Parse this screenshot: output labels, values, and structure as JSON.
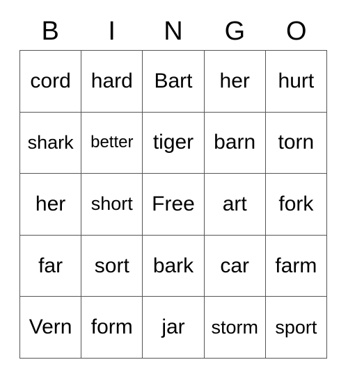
{
  "card": {
    "type": "bingo-card",
    "background_color": "#ffffff",
    "text_color": "#000000",
    "border_color": "#555555",
    "columns": 5,
    "rows": 5,
    "header": {
      "letters": [
        "B",
        "I",
        "N",
        "G",
        "O"
      ]
    },
    "grid": {
      "free_space": {
        "label": "Free",
        "row": 3,
        "column": 3
      },
      "rows": [
        [
          {
            "text": "cord",
            "size": "lg"
          },
          {
            "text": "hard",
            "size": "lg"
          },
          {
            "text": "Bart",
            "size": "lg"
          },
          {
            "text": "her",
            "size": "lg"
          },
          {
            "text": "hurt",
            "size": "lg"
          }
        ],
        [
          {
            "text": "shark",
            "size": "md"
          },
          {
            "text": "better",
            "size": "sm"
          },
          {
            "text": "tiger",
            "size": "lg"
          },
          {
            "text": "barn",
            "size": "lg"
          },
          {
            "text": "torn",
            "size": "lg"
          }
        ],
        [
          {
            "text": "her",
            "size": "lg"
          },
          {
            "text": "short",
            "size": "md"
          },
          {
            "text": "Free",
            "size": "lg"
          },
          {
            "text": "art",
            "size": "lg"
          },
          {
            "text": "fork",
            "size": "lg"
          }
        ],
        [
          {
            "text": "far",
            "size": "lg"
          },
          {
            "text": "sort",
            "size": "lg"
          },
          {
            "text": "bark",
            "size": "lg"
          },
          {
            "text": "car",
            "size": "lg"
          },
          {
            "text": "farm",
            "size": "lg"
          }
        ],
        [
          {
            "text": "Vern",
            "size": "lg"
          },
          {
            "text": "form",
            "size": "lg"
          },
          {
            "text": "jar",
            "size": "lg"
          },
          {
            "text": "storm",
            "size": "md"
          },
          {
            "text": "sport",
            "size": "md"
          }
        ]
      ]
    }
  }
}
